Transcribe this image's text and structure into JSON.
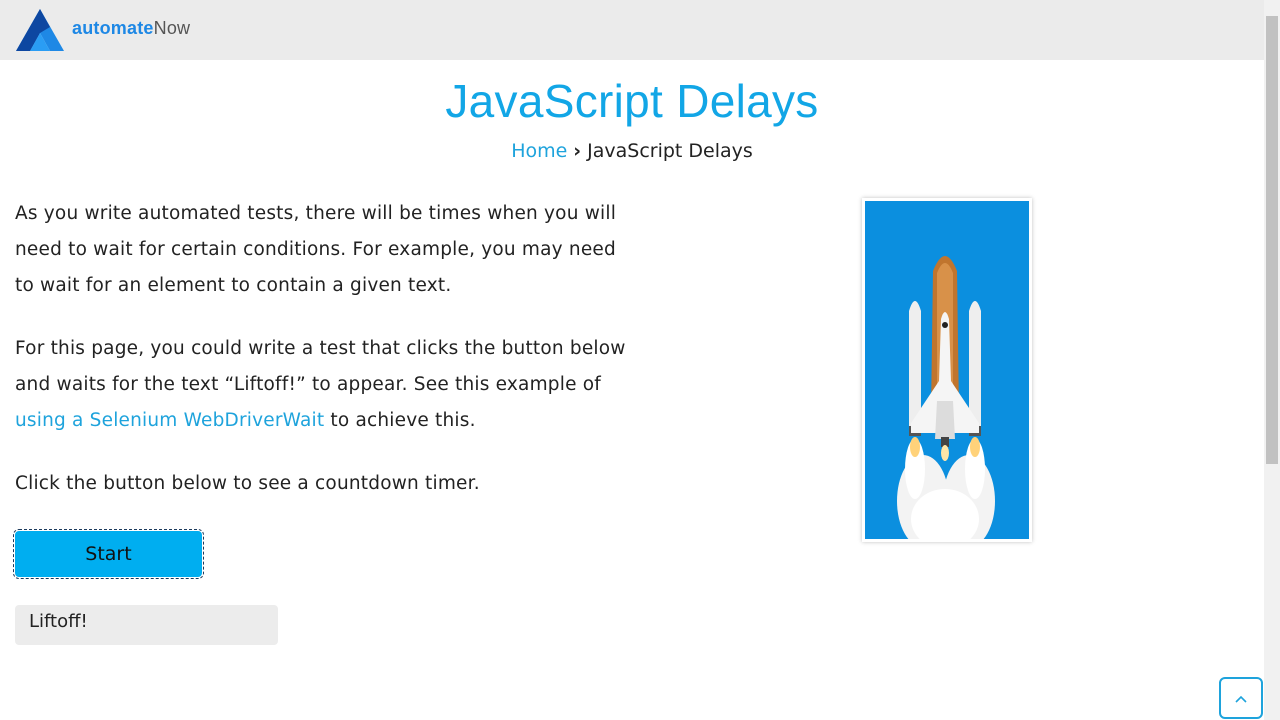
{
  "header": {
    "brand_bold": "automate",
    "brand_regular": "Now"
  },
  "page": {
    "title": "JavaScript Delays",
    "breadcrumb": {
      "home": "Home",
      "separator": "›",
      "current": "JavaScript Delays"
    }
  },
  "content": {
    "paragraph1": "As you write automated tests, there will be times when you will need to wait for certain conditions. For example, you may need to wait for an element to contain a given text.",
    "paragraph2_before": "For this page, you could write a test that clicks the button below and waits for the text “Liftoff!” to appear. See this example of ",
    "paragraph2_link": "using a Selenium WebDriverWait",
    "paragraph2_after": " to achieve this.",
    "paragraph3": "Click the button below to see a countdown timer."
  },
  "controls": {
    "start_label": "Start",
    "result_value": "Liftoff!"
  },
  "image": {
    "description_icon": "space-shuttle-launch-image"
  },
  "icons": {
    "logo": "automatenow-logo-icon",
    "back_to_top": "chevron-up-icon"
  },
  "colors": {
    "accent": "#12a6e6",
    "button": "#00aef0",
    "header_bg": "#ebebeb",
    "sky": "#0b8fdf"
  }
}
